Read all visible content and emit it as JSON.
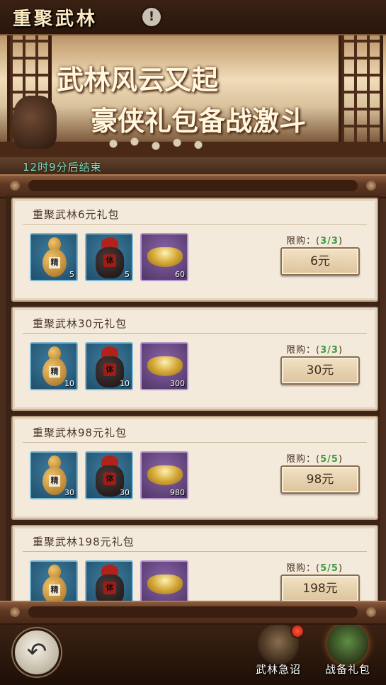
{
  "header": {
    "title": "重聚武林"
  },
  "banner": {
    "line1": "武林风云又起",
    "line2": "豪侠礼包备战激斗",
    "timer": "12时9分后结束"
  },
  "packages": [
    {
      "title": "重聚武林6元礼包",
      "limit_label": "限购：",
      "limit": "3/3",
      "price": "6元",
      "items": [
        {
          "icon": "gourd-icon",
          "count": "5"
        },
        {
          "icon": "wine-jar-icon",
          "count": "5"
        },
        {
          "icon": "gold-ingot-icon",
          "count": "60"
        }
      ]
    },
    {
      "title": "重聚武林30元礼包",
      "limit_label": "限购：",
      "limit": "3/3",
      "price": "30元",
      "items": [
        {
          "icon": "gourd-icon",
          "count": "10"
        },
        {
          "icon": "wine-jar-icon",
          "count": "10"
        },
        {
          "icon": "gold-ingot-icon",
          "count": "300"
        }
      ]
    },
    {
      "title": "重聚武林98元礼包",
      "limit_label": "限购：",
      "limit": "5/5",
      "price": "98元",
      "items": [
        {
          "icon": "gourd-icon",
          "count": "30"
        },
        {
          "icon": "wine-jar-icon",
          "count": "30"
        },
        {
          "icon": "gold-ingot-icon",
          "count": "980"
        }
      ]
    },
    {
      "title": "重聚武林198元礼包",
      "limit_label": "限购：",
      "limit": "5/5",
      "price": "198元",
      "items": [
        {
          "icon": "gourd-icon",
          "count": ""
        },
        {
          "icon": "wine-jar-icon",
          "count": ""
        },
        {
          "icon": "gold-ingot-icon",
          "count": ""
        }
      ]
    }
  ],
  "item_labels": {
    "gourd": "精",
    "jar": "体"
  },
  "bottom_nav": {
    "item1": "武林急诏",
    "item2": "战备礼包"
  }
}
